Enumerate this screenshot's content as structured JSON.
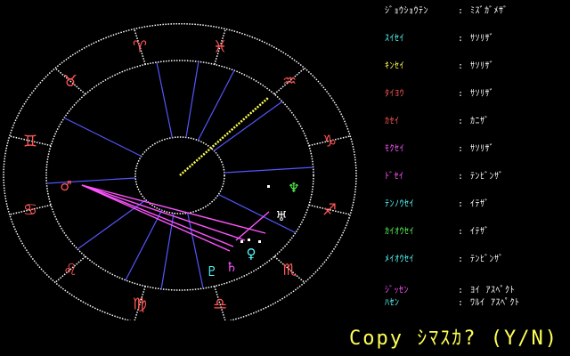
{
  "colors": {
    "wheel": "#ffffff",
    "zodiac": "#ff5555",
    "house_lines": "#5555ff",
    "aspect_good": "#ffff55",
    "aspect_bad": "#ff55ff",
    "prompt": "#ffff55"
  },
  "zodiac": [
    {
      "glyph": "♈",
      "name": "aries-glyph"
    },
    {
      "glyph": "♉",
      "name": "taurus-glyph"
    },
    {
      "glyph": "♊",
      "name": "gemini-glyph"
    },
    {
      "glyph": "♋",
      "name": "cancer-glyph"
    },
    {
      "glyph": "♌",
      "name": "leo-glyph"
    },
    {
      "glyph": "♍",
      "name": "virgo-glyph"
    },
    {
      "glyph": "♎",
      "name": "libra-glyph"
    },
    {
      "glyph": "♏",
      "name": "scorpio-glyph"
    },
    {
      "glyph": "♐",
      "name": "sagittarius-glyph"
    },
    {
      "glyph": "♑",
      "name": "capricorn-glyph"
    },
    {
      "glyph": "♒",
      "name": "aquarius-glyph"
    },
    {
      "glyph": "♓",
      "name": "pisces-glyph"
    }
  ],
  "planets": [
    {
      "glyph": "♂",
      "color": "#ff5555",
      "name": "mars-glyph"
    },
    {
      "glyph": "♆",
      "color": "#55ff55",
      "name": "neptune-glyph"
    },
    {
      "glyph": "♅",
      "color": "#ffffff",
      "name": "uranus-glyph"
    },
    {
      "glyph": "♀",
      "color": "#55ffff",
      "name": "venus-glyph"
    },
    {
      "glyph": "♇",
      "color": "#55ffff",
      "name": "pluto-glyph"
    },
    {
      "glyph": "♄",
      "color": "#ff55ff",
      "name": "saturn-glyph"
    }
  ],
  "positions": [
    {
      "name": "ｼﾞｮｳｼｮｳﾃﾝ",
      "sign": "ﾐｽﾞｶﾞﾒｻﾞ",
      "color": "#ffffff"
    },
    {
      "name": "ｽｲｾｲ",
      "sign": "ｻｿﾘｻﾞ",
      "color": "#55ffff"
    },
    {
      "name": "ｷﾝｾｲ",
      "sign": "ｻｿﾘｻﾞ",
      "color": "#ffff55"
    },
    {
      "name": "ﾀｲﾖｳ",
      "sign": "ｻｿﾘｻﾞ",
      "color": "#ff5555"
    },
    {
      "name": "ｶｾｲ",
      "sign": "ｶﾆｻﾞ",
      "color": "#ff5555"
    },
    {
      "name": "ﾓｸｾｲ",
      "sign": "ｻｿﾘｻﾞ",
      "color": "#ff55ff"
    },
    {
      "name": "ﾄﾞｾｲ",
      "sign": "ﾃﾝﾋﾞﾝｻﾞ",
      "color": "#ff55ff"
    },
    {
      "name": "ﾃﾝﾉｳｾｲ",
      "sign": "ｲﾃｻﾞ",
      "color": "#55ffff"
    },
    {
      "name": "ｶｲｵｳｾｲ",
      "sign": "ｲﾃｻﾞ",
      "color": "#55ff55"
    },
    {
      "name": "ﾒｲｵｳｾｲ",
      "sign": "ﾃﾝﾋﾞﾝｻﾞ",
      "color": "#55ffff"
    }
  ],
  "legend": [
    {
      "label": "ｼﾞｯｾﾝ",
      "value": "ﾖｲ ｱｽﾍﾟｸﾄ",
      "color": "#ff55ff"
    },
    {
      "label": "ﾊｾﾝ",
      "value": "ﾜﾙｲ ｱｽﾍﾟｸﾄ",
      "color": "#55ffff"
    }
  ],
  "separator": ":",
  "prompt": "Copy ｼﾏｽｶ? (Y/N)"
}
